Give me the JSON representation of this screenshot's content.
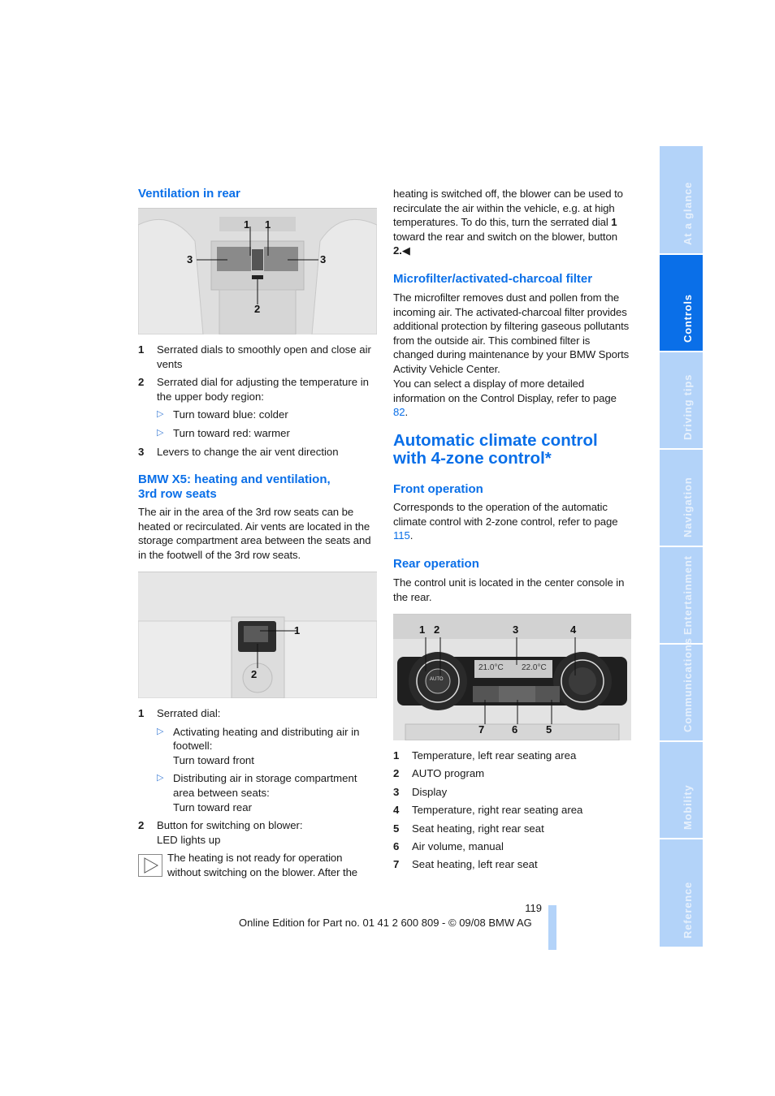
{
  "side_tabs": [
    {
      "label": "At a glance",
      "active": false
    },
    {
      "label": "Controls",
      "active": true
    },
    {
      "label": "Driving tips",
      "active": false
    },
    {
      "label": "Navigation",
      "active": false
    },
    {
      "label": "Entertainment",
      "active": false
    },
    {
      "label": "Communications",
      "active": false
    },
    {
      "label": "Mobility",
      "active": false
    },
    {
      "label": "Reference",
      "active": false
    }
  ],
  "left": {
    "ventilation": {
      "heading": "Ventilation in rear",
      "figure_callouts": [
        "1",
        "1",
        "3",
        "3",
        "2"
      ],
      "items": [
        {
          "n": "1",
          "text": "Serrated dials to smoothly open and close air vents"
        },
        {
          "n": "2",
          "text": "Serrated dial for adjusting the temperature in the upper body region:"
        },
        {
          "n": "3",
          "text": "Levers to change the air vent direction"
        }
      ],
      "sub_items": [
        "Turn toward blue: colder",
        "Turn toward red: warmer"
      ]
    },
    "third_row": {
      "heading_line1": "BMW X5: heating and ventilation,",
      "heading_line2": "3rd row seats",
      "paragraph": "The air in the area of the 3rd row seats can be heated or recirculated. Air vents are located in the storage compartment area between the seats and in the footwell of the 3rd row seats.",
      "figure_callouts": [
        "1",
        "2"
      ],
      "item1": "Serrated dial:",
      "item1_sub1_a": "Activating heating and distributing air in footwell:",
      "item1_sub1_b": "Turn toward front",
      "item1_sub2_a": "Distributing air in storage compartment area between seats:",
      "item1_sub2_b": "Turn toward rear",
      "item2_a": "Button for switching on blower:",
      "item2_b": "LED lights up",
      "note": "The heating is not ready for operation without switching on the blower. After the"
    }
  },
  "right": {
    "continued_p": {
      "part1": "heating is switched off, the blower can be used to recirculate the air within the vehicle, e.g. at high temperatures. To do this, turn the serrated dial ",
      "num1": "1",
      "part2": " toward the rear and switch on the blower, button ",
      "num2": "2.",
      "end_mark": "◀"
    },
    "microfilter": {
      "heading": "Microfilter/activated-charcoal filter",
      "paragraph": "The microfilter removes dust and pollen from the incoming air. The activated-charcoal filter provides additional protection by filtering gaseous pollutants from the outside air. This combined filter is changed during maintenance by your BMW Sports Activity Vehicle Center.",
      "p2_text": "You can select a display of more detailed information on the Control Display, refer to page ",
      "p2_link": "82",
      "p2_end": "."
    },
    "auto_climate": {
      "heading_line1": "Automatic climate control",
      "heading_line2": "with 4-zone control*",
      "front_heading": "Front operation",
      "front_text": "Corresponds to the operation of the automatic climate control with 2-zone control, refer to page ",
      "front_link": "115",
      "front_end": ".",
      "rear_heading": "Rear operation",
      "rear_text": "The control unit is located in the center console in the rear.",
      "figure": {
        "callouts": [
          "1",
          "2",
          "3",
          "4",
          "7",
          "6",
          "5"
        ],
        "display_left": "21.0°C",
        "display_right": "22.0°C",
        "auto_label": "AUTO"
      },
      "items": [
        {
          "n": "1",
          "text": "Temperature, left rear seating area"
        },
        {
          "n": "2",
          "text": "AUTO program"
        },
        {
          "n": "3",
          "text": "Display"
        },
        {
          "n": "4",
          "text": "Temperature, right rear seating area"
        },
        {
          "n": "5",
          "text": "Seat heating, right rear seat"
        },
        {
          "n": "6",
          "text": "Air volume, manual"
        },
        {
          "n": "7",
          "text": "Seat heating, left rear seat"
        }
      ]
    }
  },
  "footer": {
    "page_number": "119",
    "edition": "Online Edition for Part no. 01 41 2 600 809 - © 09/08 BMW AG"
  }
}
